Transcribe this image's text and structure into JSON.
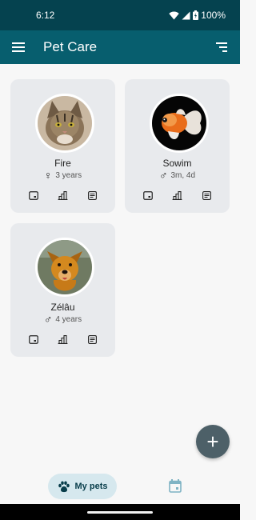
{
  "status_bar": {
    "time": "6:12",
    "battery": "100%"
  },
  "app_bar": {
    "title": "Pet Care",
    "menu_icon": "hamburger-menu-icon",
    "sort_icon": "sort-icon"
  },
  "pets": [
    {
      "name": "Fire",
      "sex_symbol": "♀",
      "sex": "female",
      "age": "3 years",
      "photo": "cat-photo"
    },
    {
      "name": "Sowim",
      "sex_symbol": "♂",
      "sex": "male",
      "age": "3m, 4d",
      "photo": "goldfish-photo"
    },
    {
      "name": "Zélâu",
      "sex_symbol": "♂",
      "sex": "male",
      "age": "4 years",
      "photo": "dog-photo"
    }
  ],
  "card_action_icons": [
    "weight-icon",
    "chart-icon",
    "notes-icon"
  ],
  "fab": {
    "label": "+"
  },
  "bottom_nav": {
    "active_label": "My pets",
    "active_icon": "paw-icon",
    "other_icon": "calendar-icon"
  },
  "colors": {
    "status_bar": "#05424f",
    "app_bar": "#075e6e",
    "card": "#e8eaed",
    "fab": "#4d6068",
    "nav_pill": "#d6e8ee",
    "background": "#f7f7f7"
  }
}
